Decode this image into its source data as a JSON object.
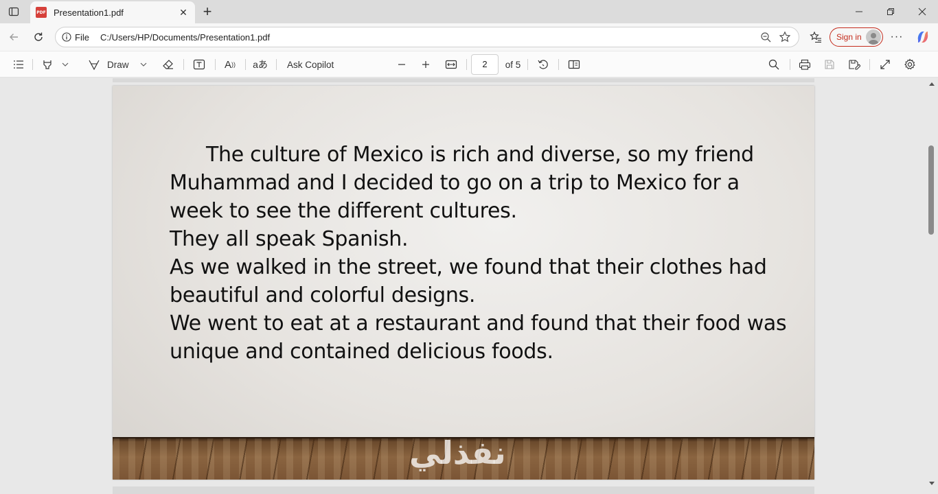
{
  "browser": {
    "tab": {
      "title": "Presentation1.pdf",
      "icon_label": "PDF"
    },
    "address": {
      "scheme_label": "File",
      "url": "C:/Users/HP/Documents/Presentation1.pdf"
    },
    "sign_in_label": "Sign in"
  },
  "pdf_toolbar": {
    "draw_label": "Draw",
    "ask_copilot_label": "Ask Copilot",
    "current_page": "2",
    "page_count_label": "of 5"
  },
  "slide": {
    "paragraphs": [
      "The culture of Mexico is rich and diverse, so my friend",
      "Muhammad and I decided to go on a trip to Mexico for a",
      "week to see the different cultures.",
      "They all speak Spanish.",
      "As we walked in the street, we found that their clothes had",
      "beautiful and colorful designs.",
      "We went to eat at a restaurant and found that their food was",
      "unique and contained delicious foods."
    ],
    "watermark": "نفذلي"
  },
  "colors": {
    "signin_accent": "#c42b1c",
    "pdf_icon": "#d6403a",
    "floor_wood": "#8a6440"
  }
}
